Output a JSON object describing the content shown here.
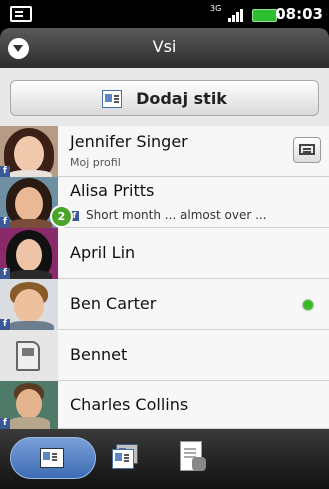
{
  "status_bar": {
    "network": "3G",
    "time": "08:03"
  },
  "header": {
    "title": "Vsi"
  },
  "add_contact": {
    "label": "Dodaj stik"
  },
  "contacts": [
    {
      "name": "Jennifer Singer",
      "subtitle": "Moj profil",
      "facebook": "f"
    },
    {
      "name": "Alisa Pritts",
      "status": "Short month ... almost over ...",
      "badge": "2",
      "facebook": "f"
    },
    {
      "name": "April Lin",
      "facebook": "f"
    },
    {
      "name": "Ben Carter",
      "online": true,
      "facebook": "f"
    },
    {
      "name": "Bennet"
    },
    {
      "name": "Charles Collins",
      "facebook": "f"
    }
  ],
  "tabs": [
    {
      "name": "people",
      "selected": true
    },
    {
      "name": "groups",
      "selected": false
    },
    {
      "name": "call-history",
      "selected": false
    }
  ],
  "colors": {
    "accent": "#3d6bb3",
    "online": "#3cb82a",
    "facebook": "#3b5998",
    "badge": "#4aa42a"
  }
}
